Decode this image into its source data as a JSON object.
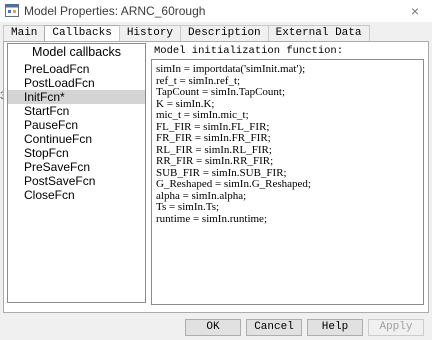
{
  "window": {
    "title": "Model Properties: ARNC_60rough",
    "close_glyph": "×",
    "icon": "simulink-model-icon"
  },
  "tabs": [
    {
      "label": "Main",
      "active": false
    },
    {
      "label": "Callbacks",
      "active": true
    },
    {
      "label": "History",
      "active": false
    },
    {
      "label": "Description",
      "active": false
    },
    {
      "label": "External Data",
      "active": false
    }
  ],
  "callbacks": {
    "header": "Model callbacks",
    "items": [
      {
        "label": "PreLoadFcn",
        "selected": false
      },
      {
        "label": "PostLoadFcn",
        "selected": false
      },
      {
        "label": "InitFcn*",
        "selected": true
      },
      {
        "label": "StartFcn",
        "selected": false
      },
      {
        "label": "PauseFcn",
        "selected": false
      },
      {
        "label": "ContinueFcn",
        "selected": false
      },
      {
        "label": "StopFcn",
        "selected": false
      },
      {
        "label": "PreSaveFcn",
        "selected": false
      },
      {
        "label": "PostSaveFcn",
        "selected": false
      },
      {
        "label": "CloseFcn",
        "selected": false
      }
    ]
  },
  "editor": {
    "label": "Model initialization function:",
    "lines": [
      "simIn = importdata('simInit.mat');",
      "ref_t = simIn.ref_t;",
      "TapCount = simIn.TapCount;",
      "K = simIn.K;",
      "mic_t = simIn.mic_t;",
      "FL_FIR = simIn.FL_FIR;",
      "FR_FIR = simIn.FR_FIR;",
      "RL_FIR = simIn.RL_FIR;",
      "RR_FIR = simIn.RR_FIR;",
      "SUB_FIR = simIn.SUB_FIR;",
      "G_Reshaped = simIn.G_Reshaped;",
      "alpha = simIn.alpha;",
      "Ts = simIn.Ts;",
      "runtime = simIn.runtime;"
    ]
  },
  "buttons": {
    "ok": "OK",
    "cancel": "Cancel",
    "help": "Help",
    "apply": "Apply",
    "apply_enabled": false
  },
  "colors": {
    "selection": "#d4d4d4",
    "dialog_bg": "#f0f0f0",
    "button_bg": "#e1e1e1",
    "disabled_text": "#a0a0a0"
  }
}
